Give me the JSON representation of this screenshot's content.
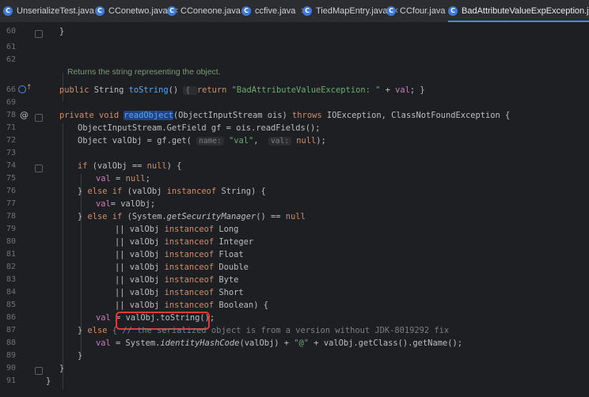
{
  "tabs": [
    {
      "label": "UnserializeTest.java"
    },
    {
      "label": "CConetwo.java"
    },
    {
      "label": "CConeone.java"
    },
    {
      "label": "ccfive.java"
    },
    {
      "label": "TiedMapEntry.java"
    },
    {
      "label": "CCfour.java"
    },
    {
      "label": "BadAttributeValueExpException.java"
    }
  ],
  "line_numbers": [
    "60",
    "61",
    "62",
    "66",
    "69",
    "78",
    "71",
    "72",
    "73",
    "74",
    "75",
    "76",
    "77",
    "78",
    "79",
    "80",
    "81",
    "82",
    "83",
    "84",
    "85",
    "86",
    "87",
    "88",
    "89",
    "90",
    "91"
  ],
  "doc_comment": "Returns the string representing the object.",
  "code": {
    "l60": "}",
    "l66_kw": "public",
    "l66_type": " String ",
    "l66_fn": "toString",
    "l66_rest1": "() ",
    "l66_brace1": "{ ",
    "l66_ret": "return",
    "l66_str": " \"BadAttributeValueException: \"",
    "l66_plus": " + ",
    "l66_val": "val",
    "l66_end": "; }",
    "l78_kw1": "private",
    "l78_kw2": " void ",
    "l78_fn": "readObject",
    "l78_rest": "(ObjectInputStream ois) ",
    "l78_throws": "throws",
    "l78_exc": " IOException, ClassNotFoundException {",
    "l71": "ObjectInputStream.GetField gf = ois.readFields();",
    "l72_a": "Object valObj = gf.get( ",
    "l72_hint1": "name:",
    "l72_str": " \"val\"",
    "l72_b": ",  ",
    "l72_hint2": "val:",
    "l72_null": " null",
    "l72_c": ");",
    "l74_if": "if",
    "l74_a": " (valObj == ",
    "l74_null": "null",
    "l74_b": ") {",
    "l75_val": "val",
    "l75_a": " = ",
    "l75_null": "null",
    "l75_b": ";",
    "l76_a": "} ",
    "l76_else": "else if",
    "l76_b": " (valObj ",
    "l76_inst": "instanceof",
    "l76_c": " String) {",
    "l77_val": "val",
    "l77_a": "= valObj;",
    "l78b_a": "} ",
    "l78b_else": "else if",
    "l78b_b": " (System.",
    "l78b_m": "getSecurityManager",
    "l78b_c": "() == ",
    "l78b_null": "null",
    "l79": "Long",
    "l80": "Integer",
    "l81": "Float",
    "l82": "Double",
    "l83": "Byte",
    "l84": "Short",
    "l85": "Boolean",
    "l85_end": ") {",
    "or_prefix": "|| valObj ",
    "instanceof": "instanceof",
    "l86_val": "val",
    "l86_a": " = ",
    "l86_b": "valObj.toString();",
    "l87_a": "} ",
    "l87_else": "else",
    "l87_b": " { // the serialized object is from a version without JDK-8019292 fix",
    "l88_val": "val",
    "l88_a": " = System.",
    "l88_m": "identityHashCode",
    "l88_b": "(valObj) + ",
    "l88_str": "\"@\"",
    "l88_c": " + valObj.getClass().getName();",
    "l89": "}",
    "l90": "}",
    "l91": "}"
  }
}
